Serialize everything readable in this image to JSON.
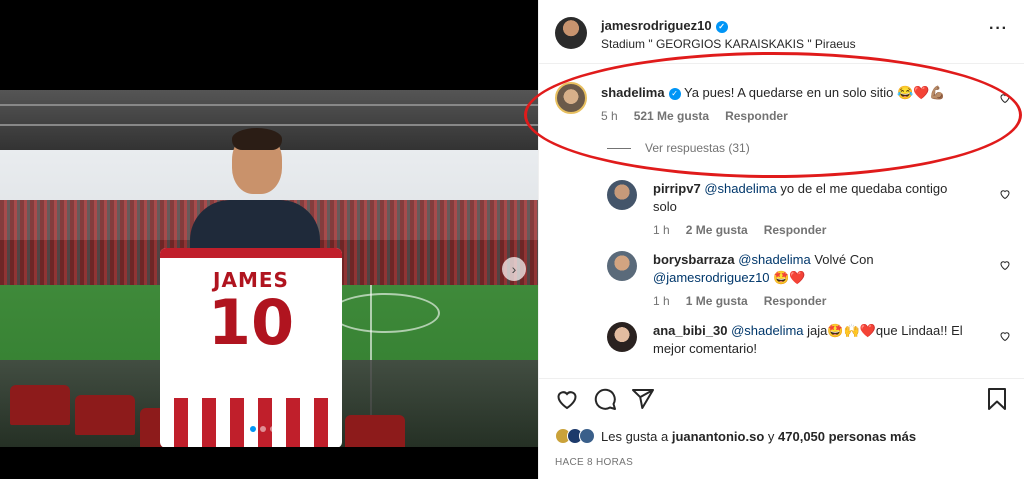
{
  "post": {
    "author": "jamesrodriguez10",
    "location": "Stadium \" GEORGIOS KARAISKAKIS \" Piraeus",
    "jersey_name": "JAMES",
    "jersey_number": "10",
    "carousel_index": 1,
    "carousel_count": 3
  },
  "comments": [
    {
      "user": "shadelima",
      "verified": true,
      "text": "Ya pues! A quedarse en un solo sitio 😂❤️💪🏽",
      "time": "5 h",
      "likes": "521 Me gusta",
      "reply": "Responder",
      "view_replies": "Ver respuestas (31)"
    },
    {
      "user": "pirripv7",
      "mention": "@shadelima",
      "text_line1": " yo de el me quedaba contigo",
      "text_line2": "solo",
      "time": "1 h",
      "likes": "2 Me gusta",
      "reply": "Responder"
    },
    {
      "user": "borysbarraza",
      "mention": "@shadelima",
      "text_line1": " Volvé Con",
      "mention2": "@jamesrodriguez10",
      "text_line2": " 🤩❤️",
      "time": "1 h",
      "likes": "1 Me gusta",
      "reply": "Responder"
    },
    {
      "user": "ana_bibi_30",
      "mention": "@shadelima",
      "text_line1": " jaja🤩🙌❤️que Lindaa!! El",
      "text_line2": "mejor comentario!"
    }
  ],
  "likes_summary": {
    "prefix": "Les gusta a ",
    "user": "juanantonio.so",
    "middle": " y ",
    "count": "470,050 personas más"
  },
  "time_ago": "HACE 8 HORAS",
  "icons": [
    "heart-icon",
    "comment-icon",
    "share-icon",
    "bookmark-icon",
    "more-icon",
    "verified-badge-icon"
  ]
}
